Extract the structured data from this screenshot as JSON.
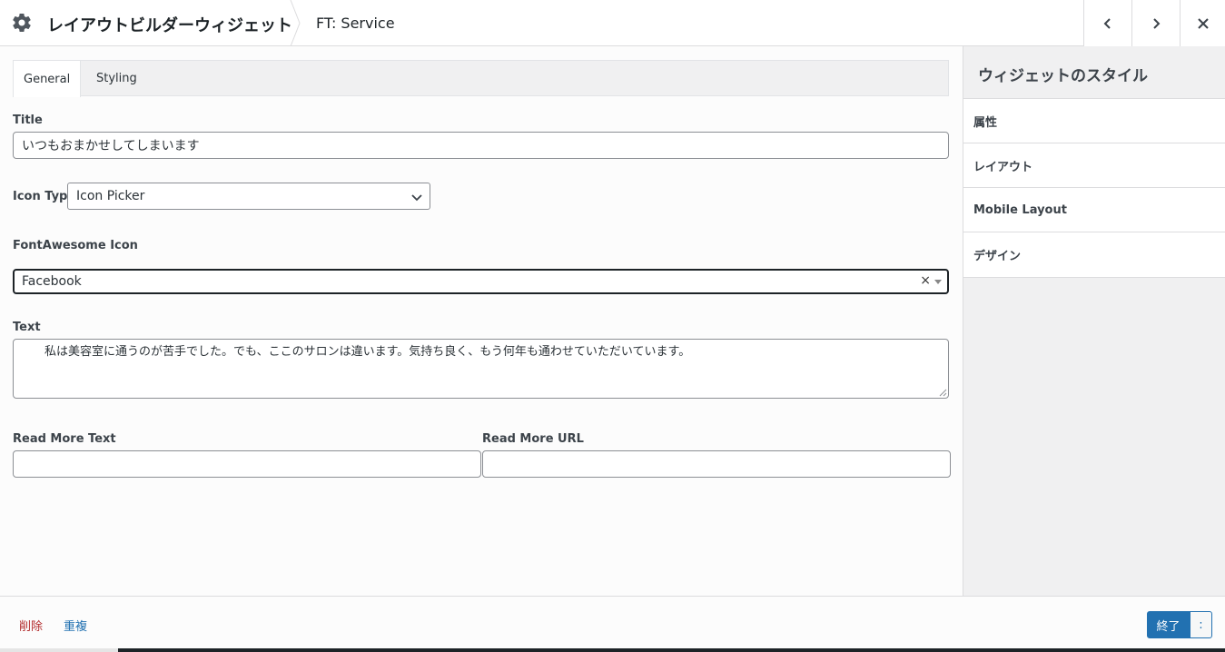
{
  "header": {
    "app_title": "レイアウトビルダーウィジェット",
    "widget_name": "FT: Service",
    "icons": {
      "settings": "gear-icon",
      "prev": "chevron-left-icon",
      "next": "chevron-right-icon",
      "close": "close-icon"
    }
  },
  "tabs": [
    {
      "label": "General",
      "active": true
    },
    {
      "label": "Styling",
      "active": false
    }
  ],
  "form": {
    "title": {
      "label": "Title",
      "value": "いつもおまかせしてしまいます"
    },
    "icon_type": {
      "label": "Icon Type",
      "value": "Icon Picker"
    },
    "fontawesome": {
      "label": "FontAwesome Icon",
      "value": "Facebook",
      "clear": "×"
    },
    "text": {
      "label": "Text",
      "value": "　　私は美容室に通うのが苦手でした。でも、ここのサロンは違います。気持ち良く、もう何年も通わせていただいています。"
    },
    "read_more_text": {
      "label": "Read More Text",
      "value": ""
    },
    "read_more_url": {
      "label": "Read More URL",
      "value": ""
    }
  },
  "sidebar": {
    "title": "ウィジェットのスタイル",
    "items": [
      {
        "label": "属性"
      },
      {
        "label": "レイアウト"
      },
      {
        "label": "Mobile Layout"
      },
      {
        "label": "デザイン"
      }
    ]
  },
  "footer": {
    "delete_label": "削除",
    "duplicate_label": "重複",
    "done_label": "終了",
    "more_label": ":"
  },
  "colors": {
    "accent": "#2271b1",
    "delete": "#b32d2e"
  }
}
